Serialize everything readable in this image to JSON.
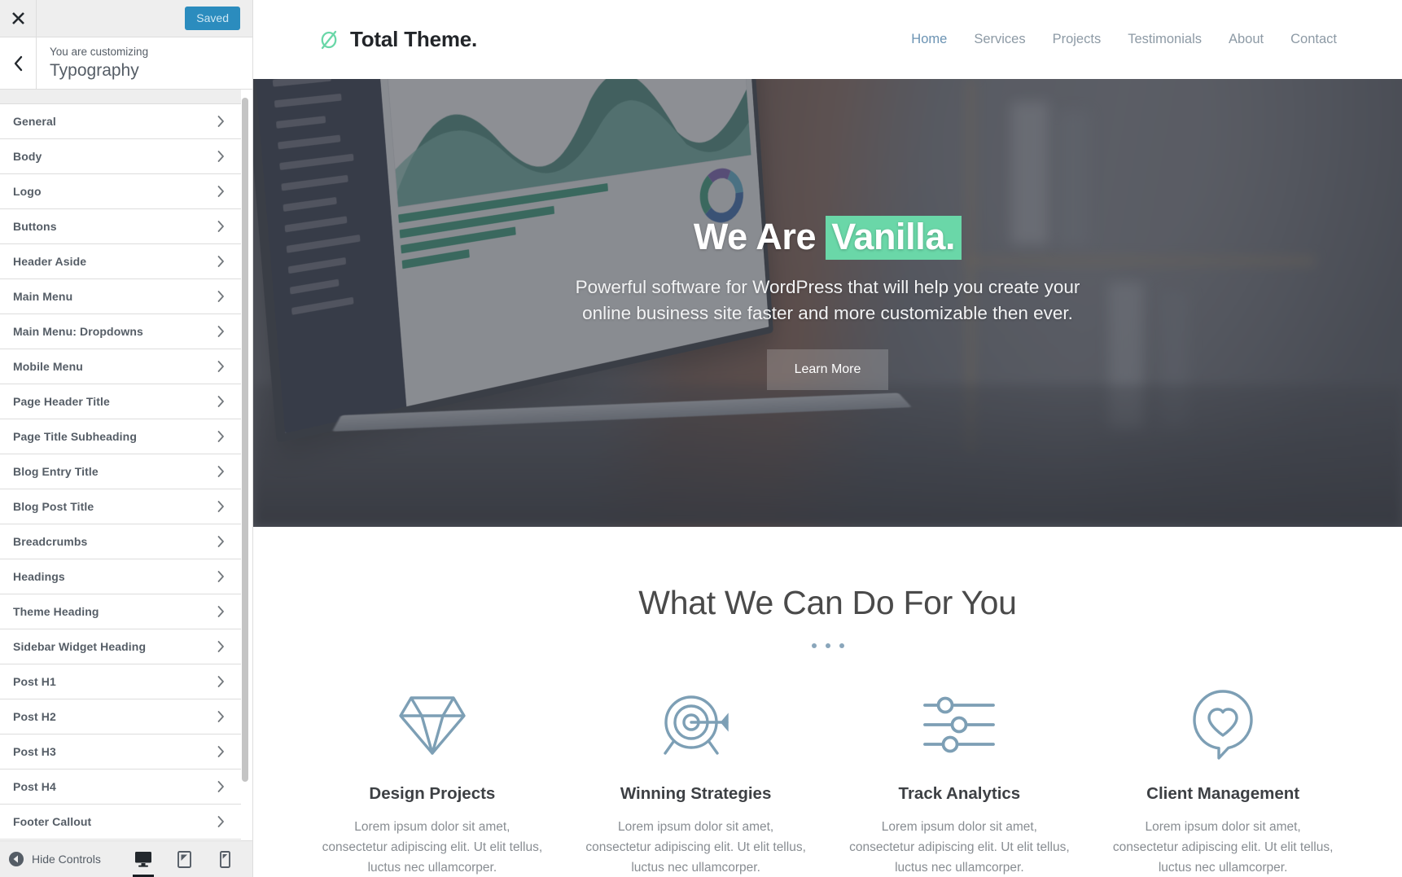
{
  "customizer": {
    "close_label": "Close",
    "saved_button": "Saved",
    "back_label": "Back",
    "customizing_prefix": "You are customizing",
    "panel_title": "Typography",
    "items": [
      {
        "label": "General"
      },
      {
        "label": "Body"
      },
      {
        "label": "Logo"
      },
      {
        "label": "Buttons"
      },
      {
        "label": "Header Aside"
      },
      {
        "label": "Main Menu"
      },
      {
        "label": "Main Menu: Dropdowns"
      },
      {
        "label": "Mobile Menu"
      },
      {
        "label": "Page Header Title"
      },
      {
        "label": "Page Title Subheading"
      },
      {
        "label": "Blog Entry Title"
      },
      {
        "label": "Blog Post Title"
      },
      {
        "label": "Breadcrumbs"
      },
      {
        "label": "Headings"
      },
      {
        "label": "Theme Heading"
      },
      {
        "label": "Sidebar Widget Heading"
      },
      {
        "label": "Post H1"
      },
      {
        "label": "Post H2"
      },
      {
        "label": "Post H3"
      },
      {
        "label": "Post H4"
      },
      {
        "label": "Footer Callout"
      }
    ],
    "footer": {
      "hide_controls": "Hide Controls",
      "devices": [
        {
          "name": "desktop",
          "active": true
        },
        {
          "name": "tablet",
          "active": false
        },
        {
          "name": "mobile",
          "active": false
        }
      ]
    },
    "colors": {
      "saved_button_bg": "#2b8cbe",
      "saved_button_text": "#cfe7f3"
    }
  },
  "site": {
    "brand": {
      "name": "Total Theme.",
      "logo_color": "#6ad7a8"
    },
    "nav": [
      {
        "label": "Home",
        "active": true
      },
      {
        "label": "Services",
        "active": false
      },
      {
        "label": "Projects",
        "active": false
      },
      {
        "label": "Testimonials",
        "active": false
      },
      {
        "label": "About",
        "active": false
      },
      {
        "label": "Contact",
        "active": false
      }
    ],
    "hero": {
      "title_plain": "We Are ",
      "title_highlight": "Vanilla.",
      "highlight_color": "#6ad7a8",
      "subtitle": "Powerful software for WordPress that will help you create your online business site faster and more customizable then ever.",
      "button_label": "Learn More"
    },
    "features": {
      "section_title": "What We Can Do For You",
      "icon_color": "#7d9fb5",
      "cards": [
        {
          "icon": "diamond-icon",
          "title": "Design Projects",
          "text": "Lorem ipsum dolor sit amet, consectetur adipiscing elit. Ut elit tellus, luctus nec ullamcorper."
        },
        {
          "icon": "target-icon",
          "title": "Winning Strategies",
          "text": "Lorem ipsum dolor sit amet, consectetur adipiscing elit. Ut elit tellus, luctus nec ullamcorper."
        },
        {
          "icon": "sliders-icon",
          "title": "Track Analytics",
          "text": "Lorem ipsum dolor sit amet, consectetur adipiscing elit. Ut elit tellus, luctus nec ullamcorper."
        },
        {
          "icon": "heart-bubble-icon",
          "title": "Client Management",
          "text": "Lorem ipsum dolor sit amet, consectetur adipiscing elit. Ut elit tellus, luctus nec ullamcorper."
        }
      ]
    }
  }
}
